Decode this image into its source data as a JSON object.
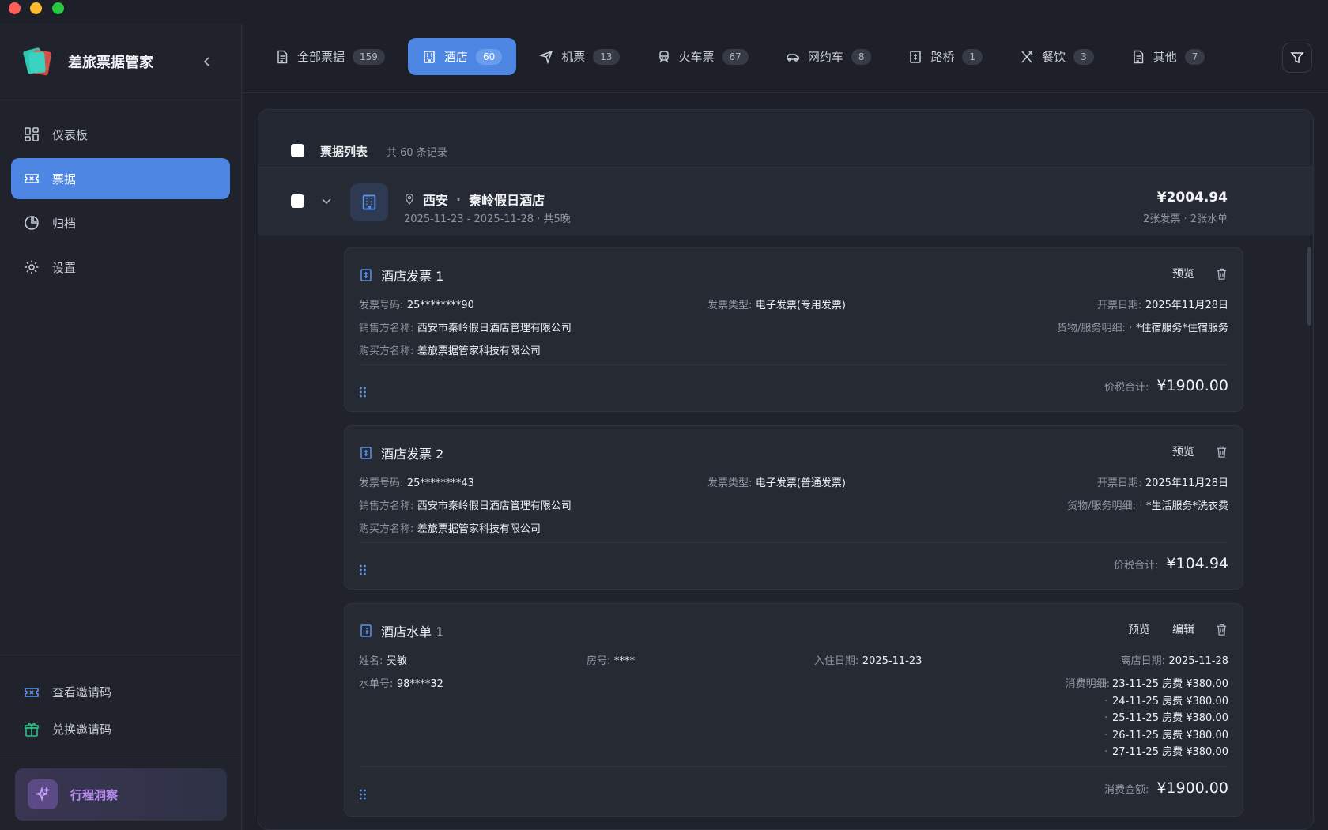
{
  "app": {
    "title": "差旅票据管家"
  },
  "sidebar": {
    "items": [
      {
        "label": "仪表板",
        "icon": "dashboard-icon"
      },
      {
        "label": "票据",
        "icon": "ticket-icon"
      },
      {
        "label": "归档",
        "icon": "pie-chart-icon"
      },
      {
        "label": "设置",
        "icon": "gear-icon"
      }
    ],
    "links": [
      {
        "label": "查看邀请码",
        "icon": "ticket-icon"
      },
      {
        "label": "兑换邀请码",
        "icon": "gift-icon"
      }
    ],
    "insight": {
      "label": "行程洞察"
    }
  },
  "tabs": [
    {
      "label": "全部票据",
      "count": "159"
    },
    {
      "label": "酒店",
      "count": "60"
    },
    {
      "label": "机票",
      "count": "13"
    },
    {
      "label": "火车票",
      "count": "67"
    },
    {
      "label": "网约车",
      "count": "8"
    },
    {
      "label": "路桥",
      "count": "1"
    },
    {
      "label": "餐饮",
      "count": "3"
    },
    {
      "label": "其他",
      "count": "7"
    }
  ],
  "list": {
    "title": "票据列表",
    "count": "共 60 条记录"
  },
  "group": {
    "city": "西安",
    "sep": "·",
    "hotel": "秦岭假日酒店",
    "dates": "2025-11-23 - 2025-11-28 · 共5晚",
    "amount": "¥2004.94",
    "meta": "2张发票 · 2张水单"
  },
  "cards": [
    {
      "title": "酒店发票 1",
      "preview": "预览",
      "invoice_no_label": "发票号码:",
      "invoice_no": "25********90",
      "type_label": "发票类型:",
      "type": "电子发票(专用发票)",
      "date_label": "开票日期:",
      "date": "2025年11月28日",
      "seller_label": "销售方名称:",
      "seller": "西安市秦岭假日酒店管理有限公司",
      "goods_label": "货物/服务明细:",
      "goods": "*住宿服务*住宿服务",
      "buyer_label": "购买方名称:",
      "buyer": "差旅票据管家科技有限公司",
      "total_label": "价税合计:",
      "total": "¥1900.00"
    },
    {
      "title": "酒店发票 2",
      "preview": "预览",
      "invoice_no_label": "发票号码:",
      "invoice_no": "25********43",
      "type_label": "发票类型:",
      "type": "电子发票(普通发票)",
      "date_label": "开票日期:",
      "date": "2025年11月28日",
      "seller_label": "销售方名称:",
      "seller": "西安市秦岭假日酒店管理有限公司",
      "goods_label": "货物/服务明细:",
      "goods": "*生活服务*洗衣费",
      "buyer_label": "购买方名称:",
      "buyer": "差旅票据管家科技有限公司",
      "total_label": "价税合计:",
      "total": "¥104.94"
    }
  ],
  "folio": {
    "title": "酒店水单 1",
    "preview": "预览",
    "edit": "编辑",
    "name_label": "姓名:",
    "name": "吴敏",
    "room_label": "房号:",
    "room": "****",
    "checkin_label": "入住日期:",
    "checkin": "2025-11-23",
    "checkout_label": "离店日期:",
    "checkout": "2025-11-28",
    "folio_no_label": "水单号:",
    "folio_no": "98****32",
    "details_label": "消费明细:",
    "details": [
      "23-11-25 房费 ¥380.00",
      "24-11-25 房费 ¥380.00",
      "25-11-25 房费 ¥380.00",
      "26-11-25 房费 ¥380.00",
      "27-11-25 房费 ¥380.00"
    ],
    "total_label": "消费金额:",
    "total": "¥1900.00"
  },
  "colors": {
    "accent": "#4d87e3",
    "insight": "#b88cf0"
  }
}
